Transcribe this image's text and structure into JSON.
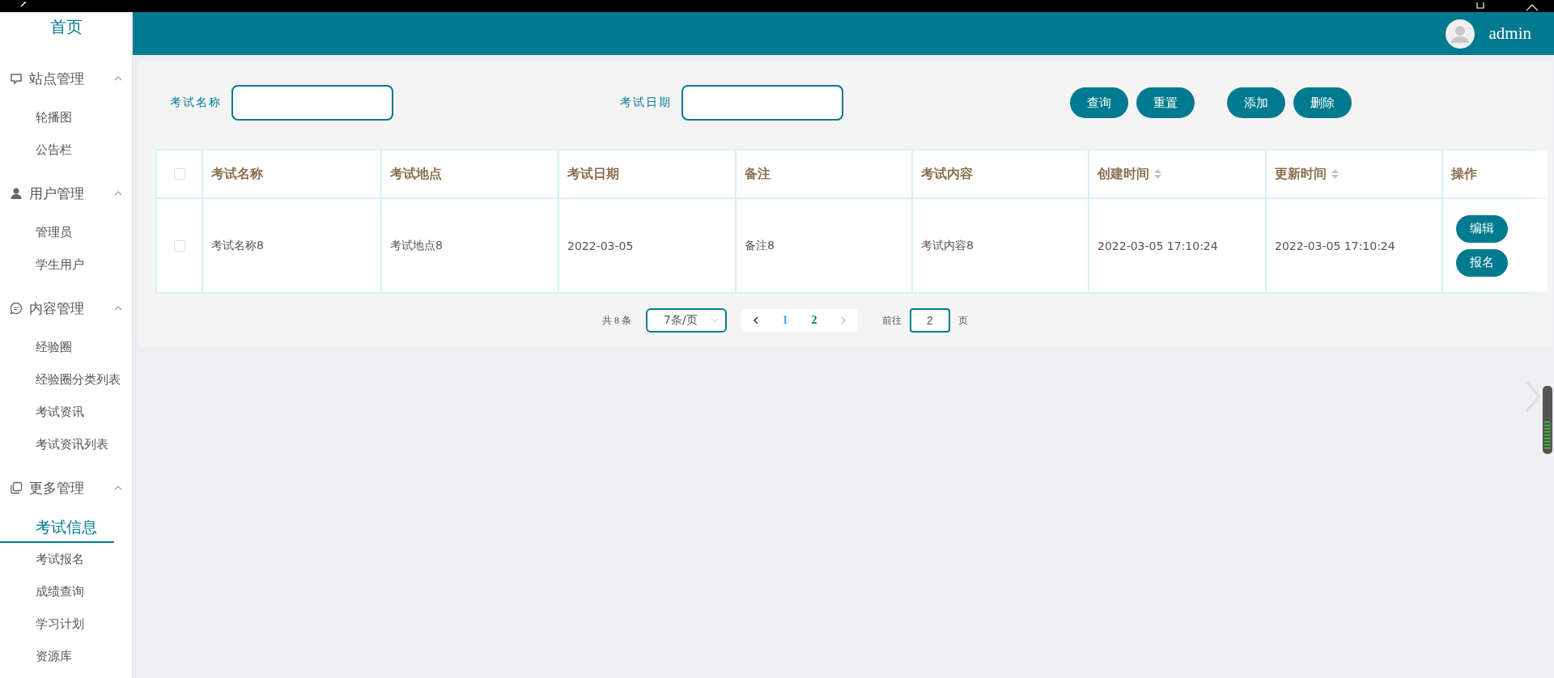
{
  "header": {
    "user": "admin"
  },
  "sidebar": {
    "home": "首页",
    "groups": [
      {
        "title": "站点管理",
        "expanded": true,
        "items": [
          {
            "label": "轮播图",
            "selected": false
          },
          {
            "label": "公告栏",
            "selected": false
          }
        ]
      },
      {
        "title": "用户管理",
        "expanded": true,
        "items": [
          {
            "label": "管理员",
            "selected": false
          },
          {
            "label": "学生用户",
            "selected": false
          }
        ]
      },
      {
        "title": "内容管理",
        "expanded": true,
        "items": [
          {
            "label": "经验圈",
            "selected": false
          },
          {
            "label": "经验圈分类列表",
            "selected": false
          },
          {
            "label": "考试资讯",
            "selected": false
          },
          {
            "label": "考试资讯列表",
            "selected": false
          }
        ]
      },
      {
        "title": "更多管理",
        "expanded": true,
        "items": [
          {
            "label": "考试信息",
            "selected": true
          },
          {
            "label": "考试报名",
            "selected": false
          },
          {
            "label": "成绩查询",
            "selected": false
          },
          {
            "label": "学习计划",
            "selected": false
          },
          {
            "label": "资源库",
            "selected": false
          }
        ]
      }
    ]
  },
  "filters": [
    {
      "label": "考试名称"
    },
    {
      "label": "考试日期"
    }
  ],
  "buttons": [
    "查询",
    "重置",
    "添加",
    "删除"
  ],
  "table": {
    "all_checked": false,
    "columns": [
      {
        "label": "考试名称",
        "sortable": false
      },
      {
        "label": "考试地点",
        "sortable": false
      },
      {
        "label": "考试日期",
        "sortable": false
      },
      {
        "label": "备注",
        "sortable": false
      },
      {
        "label": "考试内容",
        "sortable": false
      },
      {
        "label": "创建时间",
        "sortable": true
      },
      {
        "label": "更新时间",
        "sortable": true
      },
      {
        "label": "操作",
        "sortable": false
      }
    ],
    "rows": [
      {
        "checked": false,
        "cells": [
          "考试名称8",
          "考试地点8",
          "2022-03-05",
          "备注8",
          "考试内容8",
          "2022-03-05 17:10:24",
          "2022-03-05 17:10:24"
        ],
        "actions": [
          "编辑",
          "报名"
        ]
      }
    ]
  },
  "pagination": {
    "total": "共 8 条",
    "page_size": "7条/页",
    "pages": [
      {
        "label": "1",
        "selected": false
      },
      {
        "label": "2",
        "selected": true
      }
    ],
    "goto_label": "前往",
    "goto_value": "2",
    "goto_suffix": "页"
  }
}
